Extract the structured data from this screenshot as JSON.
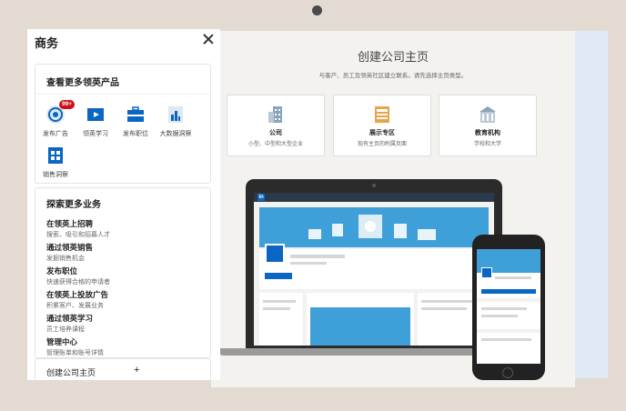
{
  "panel": {
    "title": "商务",
    "products_heading": "查看更多领英产品",
    "products": [
      {
        "label": "发布广告",
        "icon": "target-icon",
        "badge": "99+"
      },
      {
        "label": "领英学习",
        "icon": "play-icon"
      },
      {
        "label": "发布职位",
        "icon": "briefcase-icon"
      },
      {
        "label": "大数据洞察",
        "icon": "insights-icon"
      },
      {
        "label": "销售洞察",
        "icon": "sales-icon"
      }
    ],
    "explore_heading": "探索更多业务",
    "services": [
      {
        "title": "在领英上招聘",
        "desc": "搜索、吸引和招募人才"
      },
      {
        "title": "通过领英销售",
        "desc": "发掘销售机会"
      },
      {
        "title": "发布职位",
        "desc": "快速获得合格的申请者"
      },
      {
        "title": "在领英上投放广告",
        "desc": "积累客户、发展业务"
      },
      {
        "title": "通过领英学习",
        "desc": "员工培养课程"
      },
      {
        "title": "管理中心",
        "desc": "管理账单和账号详情"
      }
    ],
    "create_label": "创建公司主页",
    "create_plus": "+"
  },
  "main": {
    "title": "创建公司主页",
    "subtitle": "与客户、员工及领英社区建立联系。请先选择主页类型。",
    "options": [
      {
        "title": "公司",
        "desc": "小型、中型和大型企业",
        "icon": "building-icon"
      },
      {
        "title": "展示专区",
        "desc": "现有主页的附属页面",
        "icon": "showcase-icon"
      },
      {
        "title": "教育机构",
        "desc": "学校和大学",
        "icon": "school-icon"
      }
    ],
    "laptop_logo": "in"
  },
  "colors": {
    "brand": "#0a66c2",
    "hero": "#3f9fd8",
    "badge": "#cc1016"
  }
}
